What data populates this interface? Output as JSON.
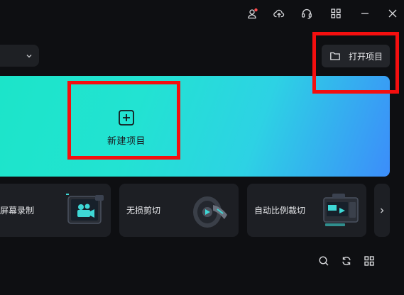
{
  "window": {
    "icons": [
      "user-notification-icon",
      "cloud-upload-icon",
      "headset-icon",
      "grid-icon",
      "minimize-icon",
      "close-icon"
    ],
    "notification_color": "#ff4d4f"
  },
  "toolbar": {
    "open_project_label": "打开项目"
  },
  "hero": {
    "new_project_label": "新建项目",
    "gradient_start": "#1ce4c9",
    "gradient_end": "#3c8dfa"
  },
  "tools": [
    {
      "label": "屏幕录制",
      "icon": "screen-record-icon"
    },
    {
      "label": "无损剪切",
      "icon": "film-reel-icon"
    },
    {
      "label": "自动比例裁切",
      "icon": "auto-crop-icon"
    }
  ],
  "bottom_icons": [
    "search-icon",
    "refresh-icon",
    "grid-view-icon"
  ],
  "highlight_color": "#f40f0f"
}
